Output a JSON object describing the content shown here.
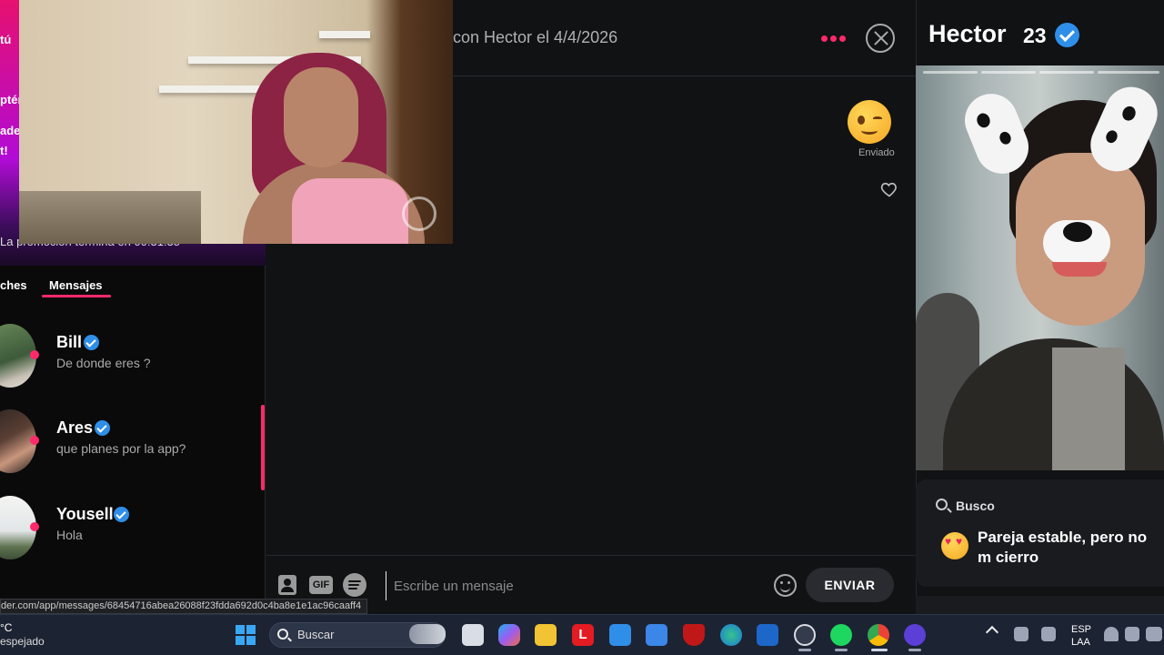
{
  "promo": {
    "line_tu": "tú",
    "line_obten": "ptén",
    "line_ade": "ade",
    "line_t": "t!",
    "countdown": "La promoción termina en 00:31:35"
  },
  "tabs": {
    "matches": "ches",
    "messages": "Mensajes"
  },
  "conversations": [
    {
      "name": "Bill",
      "preview": "De donde eres ?"
    },
    {
      "name": "Ares",
      "preview": "que planes por la app?"
    },
    {
      "name": "Yousell",
      "preview": "Hola"
    }
  ],
  "chat": {
    "match_info": "con Hector el 4/4/2026",
    "last_message_status": "Enviado",
    "input_placeholder": "Escribe un mensaje",
    "gif_label": "GIF",
    "send_label": "ENVIAR"
  },
  "profile": {
    "name": "Hector",
    "age": "23",
    "looking_for_label": "Busco",
    "looking_for_value": "Pareja estable, pero no m cierro"
  },
  "status_bar": {
    "url": "der.com/app/messages/68454716abea26088f23fdda692d0c4ba8e1e1ac96caaff4"
  },
  "taskbar": {
    "weather_temp": "°C",
    "weather_desc": "espejado",
    "search_label": "Buscar",
    "language": "ESP",
    "keyboard": "LAA"
  },
  "colors": {
    "accent": "#fd2a6b",
    "verified": "#2f8ee8",
    "background": "#111214"
  }
}
